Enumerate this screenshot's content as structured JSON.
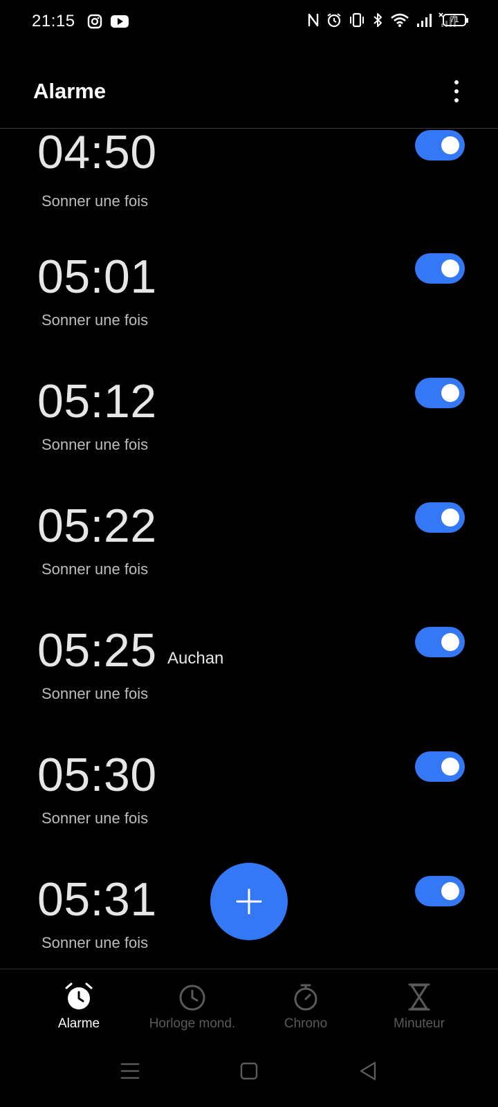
{
  "status_bar": {
    "time": "21:15",
    "left_icons": [
      "instagram-icon",
      "youtube-icon"
    ],
    "right_icons": [
      "nfc-icon",
      "alarm-clock-icon",
      "vibrate-icon",
      "bluetooth-icon",
      "wifi-icon",
      "signal-icon",
      "signal-no-service-icon"
    ],
    "battery": "71"
  },
  "header": {
    "title": "Alarme"
  },
  "alarms": [
    {
      "time": "04:50",
      "label": "",
      "repeat": "Sonner une fois",
      "enabled": true
    },
    {
      "time": "05:01",
      "label": "",
      "repeat": "Sonner une fois",
      "enabled": true
    },
    {
      "time": "05:12",
      "label": "",
      "repeat": "Sonner une fois",
      "enabled": true
    },
    {
      "time": "05:22",
      "label": "",
      "repeat": "Sonner une fois",
      "enabled": true
    },
    {
      "time": "05:25",
      "label": "Auchan",
      "repeat": "Sonner une fois",
      "enabled": true
    },
    {
      "time": "05:30",
      "label": "",
      "repeat": "Sonner une fois",
      "enabled": true
    },
    {
      "time": "05:31",
      "label": "",
      "repeat": "Sonner une fois",
      "enabled": true
    }
  ],
  "fab": {
    "icon": "plus-icon"
  },
  "bottom_nav": {
    "tabs": [
      {
        "label": "Alarme",
        "icon": "alarm-clock-icon",
        "active": true
      },
      {
        "label": "Horloge mond.",
        "icon": "clock-icon",
        "active": false
      },
      {
        "label": "Chrono",
        "icon": "stopwatch-icon",
        "active": false
      },
      {
        "label": "Minuteur",
        "icon": "hourglass-icon",
        "active": false
      }
    ]
  },
  "colors": {
    "accent": "#3478f6",
    "background": "#000000",
    "text_primary": "#e6e6e6",
    "text_secondary": "#bdbdbd",
    "inactive_tab": "#5a5a5a"
  }
}
